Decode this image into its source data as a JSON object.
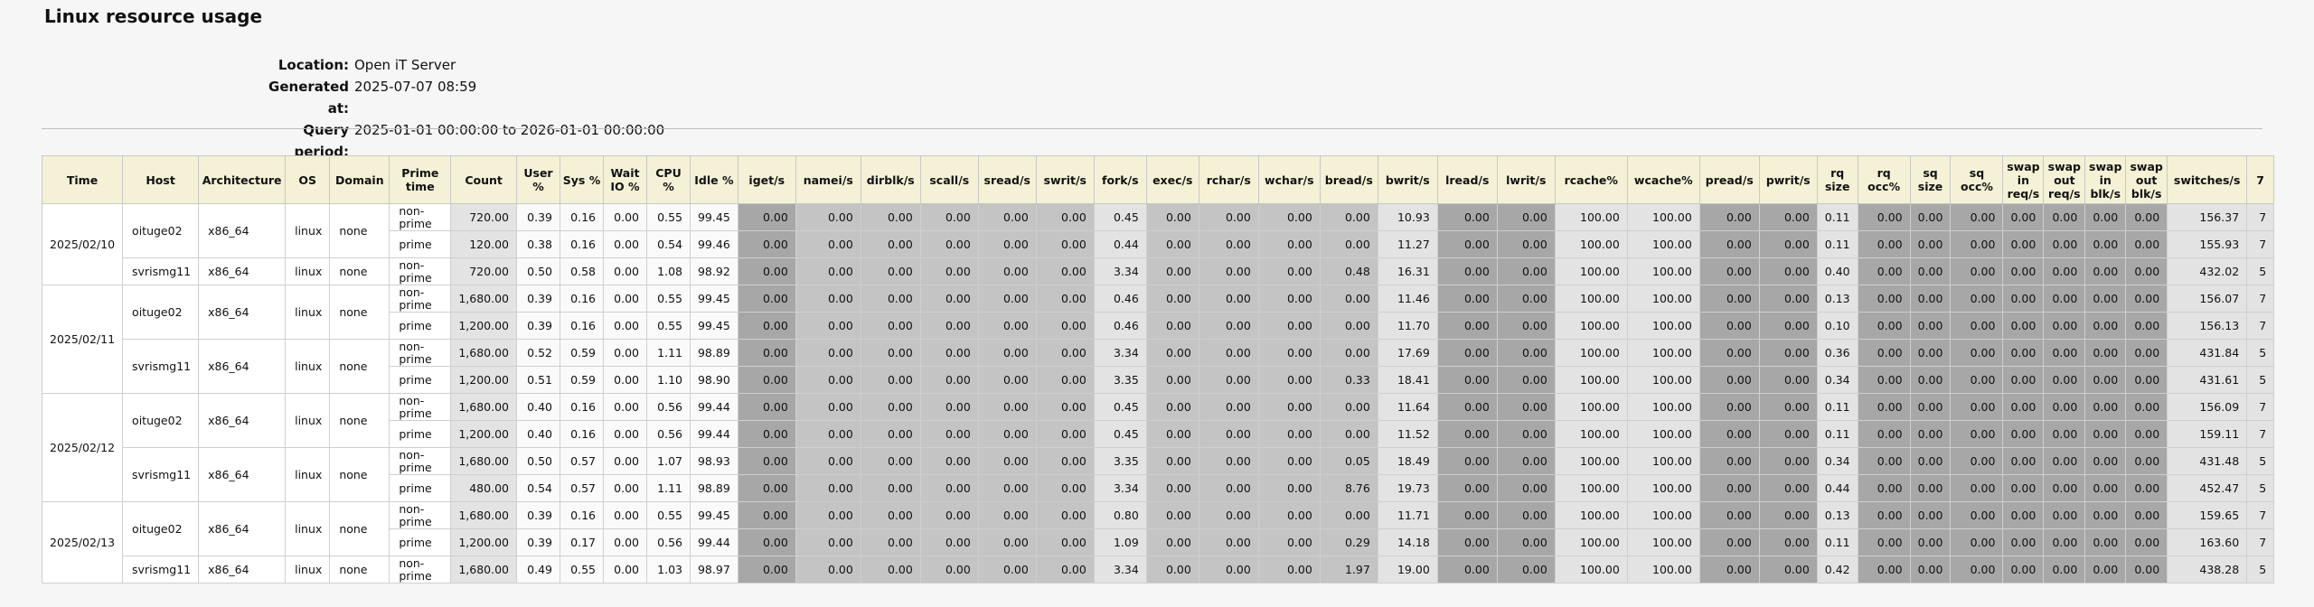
{
  "title": "Linux resource usage",
  "meta": [
    {
      "label": "Location:",
      "value": "Open iT Server"
    },
    {
      "label": "Generated at:",
      "value": "2025-07-07 08:59"
    },
    {
      "label": "Query period:",
      "value": "2025-01-01 00:00:00 to 2026-01-01 00:00:00"
    }
  ],
  "columns": [
    "Time",
    "Host",
    "Architecture",
    "OS",
    "Domain",
    "Prime time",
    "Count",
    "User %",
    "Sys %",
    "Wait IO %",
    "CPU %",
    "Idle %",
    "iget/s",
    "namei/s",
    "dirblk/s",
    "scall/s",
    "sread/s",
    "swrit/s",
    "fork/s",
    "exec/s",
    "rchar/s",
    "wchar/s",
    "bread/s",
    "bwrit/s",
    "lread/s",
    "lwrit/s",
    "rcache%",
    "wcache%",
    "pread/s",
    "pwrit/s",
    "rq size",
    "rq occ%",
    "sq size",
    "sq occ%",
    "swap in req/s",
    "swap out req/s",
    "swap in blk/s",
    "swap out blk/s",
    "switches/s",
    "7"
  ],
  "rows": [
    {
      "values": [
        "oituge02",
        "x86_64",
        "linux",
        "none",
        "non-prime",
        "720.00",
        "0.39",
        "0.16",
        "0.00",
        "0.55",
        "99.45",
        "0.00",
        "0.00",
        "0.00",
        "0.00",
        "0.00",
        "0.00",
        "0.45",
        "0.00",
        "0.00",
        "0.00",
        "0.00",
        "10.93",
        "0.00",
        "0.00",
        "100.00",
        "100.00",
        "0.00",
        "0.00",
        "0.11",
        "0.00",
        "0.00",
        "0.00",
        "0.00",
        "0.00",
        "0.00",
        "0.00",
        "156.37",
        "7"
      ]
    },
    {
      "values": [
        "prime",
        "120.00",
        "0.38",
        "0.16",
        "0.00",
        "0.54",
        "99.46",
        "0.00",
        "0.00",
        "0.00",
        "0.00",
        "0.00",
        "0.00",
        "0.44",
        "0.00",
        "0.00",
        "0.00",
        "0.00",
        "11.27",
        "0.00",
        "0.00",
        "100.00",
        "100.00",
        "0.00",
        "0.00",
        "0.11",
        "0.00",
        "0.00",
        "0.00",
        "0.00",
        "0.00",
        "0.00",
        "0.00",
        "155.93",
        "7"
      ]
    },
    {
      "values": [
        "svrismg11",
        "x86_64",
        "linux",
        "none",
        "non-prime",
        "720.00",
        "0.50",
        "0.58",
        "0.00",
        "1.08",
        "98.92",
        "0.00",
        "0.00",
        "0.00",
        "0.00",
        "0.00",
        "0.00",
        "3.34",
        "0.00",
        "0.00",
        "0.00",
        "0.48",
        "16.31",
        "0.00",
        "0.00",
        "100.00",
        "100.00",
        "0.00",
        "0.00",
        "0.40",
        "0.00",
        "0.00",
        "0.00",
        "0.00",
        "0.00",
        "0.00",
        "0.00",
        "432.02",
        "5"
      ]
    },
    {
      "values": [
        "oituge02",
        "x86_64",
        "linux",
        "none",
        "non-prime",
        "1,680.00",
        "0.39",
        "0.16",
        "0.00",
        "0.55",
        "99.45",
        "0.00",
        "0.00",
        "0.00",
        "0.00",
        "0.00",
        "0.00",
        "0.46",
        "0.00",
        "0.00",
        "0.00",
        "0.00",
        "11.46",
        "0.00",
        "0.00",
        "100.00",
        "100.00",
        "0.00",
        "0.00",
        "0.13",
        "0.00",
        "0.00",
        "0.00",
        "0.00",
        "0.00",
        "0.00",
        "0.00",
        "156.07",
        "7"
      ]
    },
    {
      "values": [
        "prime",
        "1,200.00",
        "0.39",
        "0.16",
        "0.00",
        "0.55",
        "99.45",
        "0.00",
        "0.00",
        "0.00",
        "0.00",
        "0.00",
        "0.00",
        "0.46",
        "0.00",
        "0.00",
        "0.00",
        "0.00",
        "11.70",
        "0.00",
        "0.00",
        "100.00",
        "100.00",
        "0.00",
        "0.00",
        "0.10",
        "0.00",
        "0.00",
        "0.00",
        "0.00",
        "0.00",
        "0.00",
        "0.00",
        "156.13",
        "7"
      ]
    },
    {
      "values": [
        "svrismg11",
        "x86_64",
        "linux",
        "none",
        "non-prime",
        "1,680.00",
        "0.52",
        "0.59",
        "0.00",
        "1.11",
        "98.89",
        "0.00",
        "0.00",
        "0.00",
        "0.00",
        "0.00",
        "0.00",
        "3.34",
        "0.00",
        "0.00",
        "0.00",
        "0.00",
        "17.69",
        "0.00",
        "0.00",
        "100.00",
        "100.00",
        "0.00",
        "0.00",
        "0.36",
        "0.00",
        "0.00",
        "0.00",
        "0.00",
        "0.00",
        "0.00",
        "0.00",
        "431.84",
        "5"
      ]
    },
    {
      "values": [
        "prime",
        "1,200.00",
        "0.51",
        "0.59",
        "0.00",
        "1.10",
        "98.90",
        "0.00",
        "0.00",
        "0.00",
        "0.00",
        "0.00",
        "0.00",
        "3.35",
        "0.00",
        "0.00",
        "0.00",
        "0.33",
        "18.41",
        "0.00",
        "0.00",
        "100.00",
        "100.00",
        "0.00",
        "0.00",
        "0.34",
        "0.00",
        "0.00",
        "0.00",
        "0.00",
        "0.00",
        "0.00",
        "0.00",
        "431.61",
        "5"
      ]
    },
    {
      "values": [
        "oituge02",
        "x86_64",
        "linux",
        "none",
        "non-prime",
        "1,680.00",
        "0.40",
        "0.16",
        "0.00",
        "0.56",
        "99.44",
        "0.00",
        "0.00",
        "0.00",
        "0.00",
        "0.00",
        "0.00",
        "0.45",
        "0.00",
        "0.00",
        "0.00",
        "0.00",
        "11.64",
        "0.00",
        "0.00",
        "100.00",
        "100.00",
        "0.00",
        "0.00",
        "0.11",
        "0.00",
        "0.00",
        "0.00",
        "0.00",
        "0.00",
        "0.00",
        "0.00",
        "156.09",
        "7"
      ]
    },
    {
      "values": [
        "prime",
        "1,200.00",
        "0.40",
        "0.16",
        "0.00",
        "0.56",
        "99.44",
        "0.00",
        "0.00",
        "0.00",
        "0.00",
        "0.00",
        "0.00",
        "0.45",
        "0.00",
        "0.00",
        "0.00",
        "0.00",
        "11.52",
        "0.00",
        "0.00",
        "100.00",
        "100.00",
        "0.00",
        "0.00",
        "0.11",
        "0.00",
        "0.00",
        "0.00",
        "0.00",
        "0.00",
        "0.00",
        "0.00",
        "159.11",
        "7"
      ]
    },
    {
      "values": [
        "svrismg11",
        "x86_64",
        "linux",
        "none",
        "non-prime",
        "1,680.00",
        "0.50",
        "0.57",
        "0.00",
        "1.07",
        "98.93",
        "0.00",
        "0.00",
        "0.00",
        "0.00",
        "0.00",
        "0.00",
        "3.35",
        "0.00",
        "0.00",
        "0.00",
        "0.05",
        "18.49",
        "0.00",
        "0.00",
        "100.00",
        "100.00",
        "0.00",
        "0.00",
        "0.34",
        "0.00",
        "0.00",
        "0.00",
        "0.00",
        "0.00",
        "0.00",
        "0.00",
        "431.48",
        "5"
      ]
    },
    {
      "values": [
        "prime",
        "480.00",
        "0.54",
        "0.57",
        "0.00",
        "1.11",
        "98.89",
        "0.00",
        "0.00",
        "0.00",
        "0.00",
        "0.00",
        "0.00",
        "3.34",
        "0.00",
        "0.00",
        "0.00",
        "8.76",
        "19.73",
        "0.00",
        "0.00",
        "100.00",
        "100.00",
        "0.00",
        "0.00",
        "0.44",
        "0.00",
        "0.00",
        "0.00",
        "0.00",
        "0.00",
        "0.00",
        "0.00",
        "452.47",
        "5"
      ]
    },
    {
      "values": [
        "oituge02",
        "x86_64",
        "linux",
        "none",
        "non-prime",
        "1,680.00",
        "0.39",
        "0.16",
        "0.00",
        "0.55",
        "99.45",
        "0.00",
        "0.00",
        "0.00",
        "0.00",
        "0.00",
        "0.00",
        "0.80",
        "0.00",
        "0.00",
        "0.00",
        "0.00",
        "11.71",
        "0.00",
        "0.00",
        "100.00",
        "100.00",
        "0.00",
        "0.00",
        "0.13",
        "0.00",
        "0.00",
        "0.00",
        "0.00",
        "0.00",
        "0.00",
        "0.00",
        "159.65",
        "7"
      ]
    },
    {
      "values": [
        "prime",
        "1,200.00",
        "0.39",
        "0.17",
        "0.00",
        "0.56",
        "99.44",
        "0.00",
        "0.00",
        "0.00",
        "0.00",
        "0.00",
        "0.00",
        "1.09",
        "0.00",
        "0.00",
        "0.00",
        "0.29",
        "14.18",
        "0.00",
        "0.00",
        "100.00",
        "100.00",
        "0.00",
        "0.00",
        "0.11",
        "0.00",
        "0.00",
        "0.00",
        "0.00",
        "0.00",
        "0.00",
        "0.00",
        "163.60",
        "7"
      ]
    },
    {
      "values": [
        "svrismg11",
        "x86_64",
        "linux",
        "none",
        "non-prime",
        "1,680.00",
        "0.49",
        "0.55",
        "0.00",
        "1.03",
        "98.97",
        "0.00",
        "0.00",
        "0.00",
        "0.00",
        "0.00",
        "0.00",
        "3.34",
        "0.00",
        "0.00",
        "0.00",
        "1.97",
        "19.00",
        "0.00",
        "0.00",
        "100.00",
        "100.00",
        "0.00",
        "0.00",
        "0.42",
        "0.00",
        "0.00",
        "0.00",
        "0.00",
        "0.00",
        "0.00",
        "0.00",
        "438.28",
        "5"
      ]
    }
  ],
  "dates": [
    {
      "label": "2025/02/10",
      "rowspan": 3
    },
    {
      "label": "2025/02/11",
      "rowspan": 4
    },
    {
      "label": "2025/02/12",
      "rowspan": 4
    },
    {
      "label": "2025/02/13",
      "rowspan": 3
    }
  ],
  "hostSpans": [
    [
      2,
      1
    ],
    [
      2,
      2
    ],
    [
      2,
      2
    ],
    [
      2,
      1
    ]
  ]
}
